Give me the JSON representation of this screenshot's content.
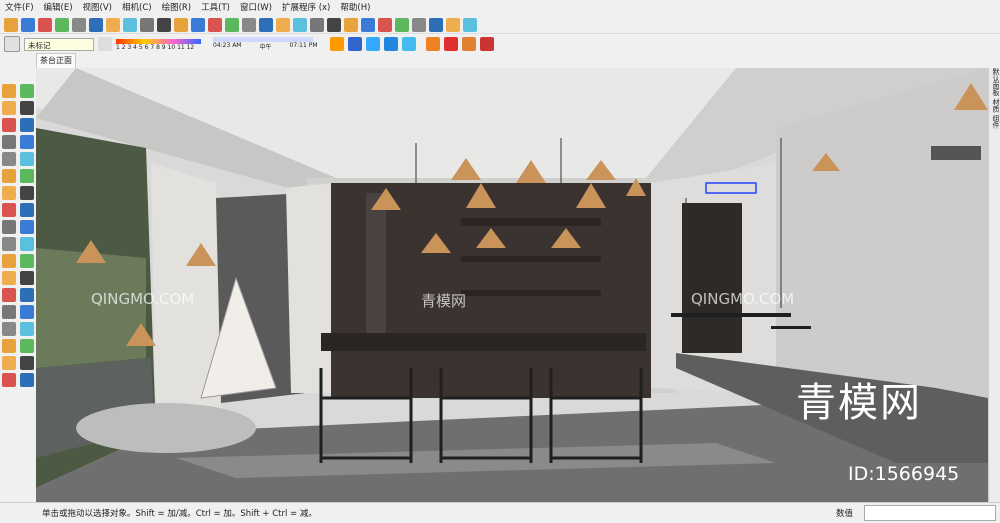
{
  "menu": [
    "文件(F)",
    "编辑(E)",
    "视图(V)",
    "相机(C)",
    "绘图(R)",
    "工具(T)",
    "窗口(W)",
    "扩展程序 (x)",
    "帮助(H)"
  ],
  "style": {
    "selected": "未标记"
  },
  "shadow": {
    "months": "1 2 3 4 5 6 7 8 9 10 11 12",
    "time_start": "04:23 AM",
    "time_mid": "中午",
    "time_end": "07:11 PM"
  },
  "scene": {
    "tab_label": "茶台正面"
  },
  "tray": {
    "tabs": [
      "默认面板",
      "材质",
      "组件"
    ]
  },
  "watermarks": {
    "site": "QINGMO.COM",
    "cn": "青模网",
    "big": "青模网",
    "id": "ID:1566945"
  },
  "status": {
    "hint": "单击或拖动以选择对象。Shift = 加/减。Ctrl = 加。Shift + Ctrl = 减。",
    "measure_label": "数值",
    "measure_value": ""
  },
  "colors": {
    "chrome": "#f0f0f0",
    "ceiling": "#e8e8e6",
    "floor": "#6f6f6f",
    "cabinet": "#3b3330",
    "lamp": "#c9935a"
  },
  "icons": {
    "toolbar1": [
      "file-new-icon",
      "open-icon",
      "save-icon",
      "cut-icon",
      "copy-icon",
      "paste-icon",
      "erase-icon",
      "undo-icon",
      "redo-icon",
      "print-icon",
      "model-info-icon",
      "components-icon",
      "materials-icon",
      "styles-icon",
      "layers-icon",
      "outliner-icon",
      "scenes-icon",
      "shadows-icon",
      "fog-icon",
      "match-photo-icon",
      "soften-edges-icon",
      "play-icon",
      "pause-icon",
      "record-icon",
      "stop-icon",
      "sandbox-icon",
      "solid-tools-icon",
      "extension-tool-icon"
    ],
    "left": [
      "select-icon",
      "make-component-icon",
      "paint-bucket-icon",
      "eraser-icon",
      "line-icon",
      "freehand-icon",
      "rectangle-icon",
      "rotated-rectangle-icon",
      "circle-icon",
      "polygon-icon",
      "arc-icon",
      "pie-icon",
      "move-icon",
      "push-pull-icon",
      "rotate-icon",
      "follow-me-icon",
      "scale-icon",
      "offset-icon",
      "tape-measure-icon",
      "dimension-icon",
      "protractor-icon",
      "text-icon",
      "axes-icon",
      "3d-text-icon",
      "orbit-icon",
      "pan-icon",
      "zoom-icon",
      "zoom-window-icon",
      "zoom-extents-icon",
      "previous-view-icon",
      "position-camera-icon",
      "look-around-icon",
      "walk-icon",
      "section-plane-icon",
      "warehouse-icon",
      "extension-warehouse-icon"
    ]
  }
}
